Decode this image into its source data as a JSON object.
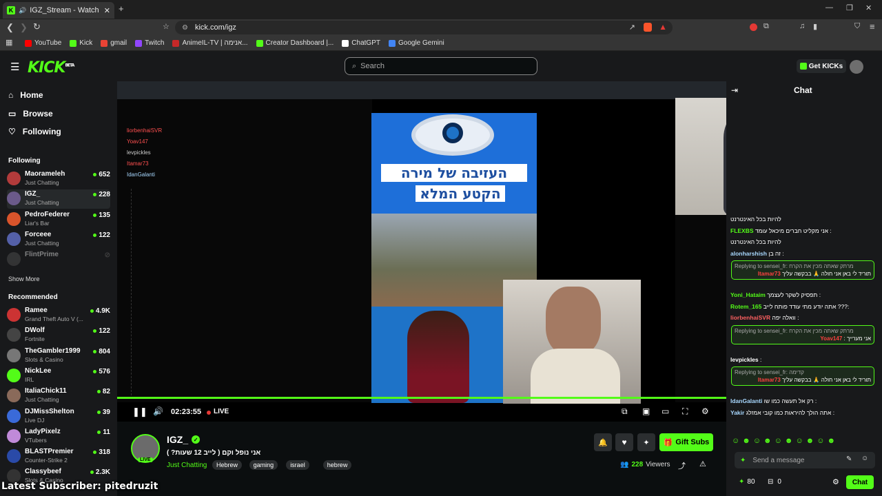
{
  "browser": {
    "tab_title": "IGZ_Stream - Watch Live on K",
    "url": "kick.com/igz",
    "bookmarks": [
      {
        "label": "YouTube",
        "color": "#ff0000"
      },
      {
        "label": "Kick",
        "color": "#53fc18"
      },
      {
        "label": "gmail",
        "color": "#ea4335"
      },
      {
        "label": "Twitch",
        "color": "#9146ff"
      },
      {
        "label": "AnimeIL-TV | אנימה...",
        "color": "#c62828"
      },
      {
        "label": "Creator Dashboard |...",
        "color": "#53fc18"
      },
      {
        "label": "ChatGPT",
        "color": "#ffffff"
      },
      {
        "label": "Google Gemini",
        "color": "#4285f4"
      }
    ]
  },
  "header": {
    "logo": "KICK",
    "logo_beta": "BETA",
    "search_placeholder": "Search",
    "get_kicks": "Get KICKs"
  },
  "sidebar": {
    "nav": [
      "Home",
      "Browse",
      "Following"
    ],
    "following_title": "Following",
    "following": [
      {
        "name": "Maorameleh",
        "category": "Just Chatting",
        "viewers": "652",
        "color": "#b23b3b"
      },
      {
        "name": "IGZ_",
        "category": "Just Chatting",
        "viewers": "228",
        "color": "#6b5a8a"
      },
      {
        "name": "PedroFederer",
        "category": "Liar's Bar",
        "viewers": "135",
        "color": "#d9542b"
      },
      {
        "name": "Forceee",
        "category": "Just Chatting",
        "viewers": "122",
        "color": "#5460a8"
      },
      {
        "name": "FlintPrime",
        "category": "",
        "viewers": "",
        "color": "#555555"
      }
    ],
    "show_more": "Show More",
    "recommended_title": "Recommended",
    "recommended": [
      {
        "name": "Ramee",
        "category": "Grand Theft Auto V (...",
        "viewers": "4.9K",
        "color": "#cc3333"
      },
      {
        "name": "DWolf",
        "category": "Fortnite",
        "viewers": "122",
        "color": "#444444"
      },
      {
        "name": "TheGambler1999",
        "category": "Slots & Casino",
        "viewers": "804",
        "color": "#777777"
      },
      {
        "name": "NickLee",
        "category": "IRL",
        "viewers": "576",
        "color": "#53fc18"
      },
      {
        "name": "ItaliaChick11",
        "category": "Just Chatting",
        "viewers": "82",
        "color": "#8a6a5a"
      },
      {
        "name": "DJMissShelton",
        "category": "Live DJ",
        "viewers": "39",
        "color": "#3a6ad9"
      },
      {
        "name": "LadyPixelz",
        "category": "VTubers",
        "viewers": "11",
        "color": "#c08ad9"
      },
      {
        "name": "BLASTPremier",
        "category": "Counter-Strike 2",
        "viewers": "318",
        "color": "#2a4aa8"
      },
      {
        "name": "Classybeef",
        "category": "Slots & Casino",
        "viewers": "2.3K",
        "color": "#333333"
      }
    ]
  },
  "player": {
    "time": "02:23:55",
    "live_label": "LIVE",
    "overlay_text_1": "העזיבה של מירה",
    "overlay_text_2": "הקטע המלא",
    "progress": 1.0
  },
  "stream": {
    "streamer": "IGZ_",
    "live_badge": "LIVE",
    "title": "אני נופל וקם ( לייב 12 שעות? )",
    "category": "Just Chatting",
    "tags": [
      "Hebrew",
      "gaming",
      "israel",
      "hebrew"
    ],
    "viewers": "228",
    "viewers_label": "Viewers",
    "gift_subs": "Gift Subs"
  },
  "chat": {
    "title": "Chat",
    "messages": [
      {
        "type": "text",
        "user": "",
        "user_color": "#fff",
        "text": "להיות בכל האינטרנט"
      },
      {
        "type": "text",
        "user": "FLEXBS",
        "user_color": "#53fc18",
        "text": "אני מקליט חברים מיכאל עומד :"
      },
      {
        "type": "text",
        "user": "",
        "user_color": "#fff",
        "text": "להיות בכל האינטרנט"
      },
      {
        "type": "text",
        "user": "alonharshish",
        "user_color": "#a8d8ff",
        "text": "זה בן :"
      },
      {
        "type": "reply",
        "reply_to": "Replying to sensei_fr: מרתק שאתה מכין את הקרח",
        "user": "Itamar73",
        "user_color": "#ff4040",
        "text": "תוריד לי באן אני חולה 🙏 בבקשה עליך"
      },
      {
        "type": "text",
        "user": "Yoni_Hataim",
        "user_color": "#53fc18",
        "text": "תפסיק לשקר לעצמך :"
      },
      {
        "type": "text",
        "user": "Rotem_165",
        "user_color": "#53fc18",
        "text": "אתה יודע מתי עודד פותח לייב ???:"
      },
      {
        "type": "text",
        "user": "liorbenhaiSVR",
        "user_color": "#ff6060",
        "text": "וואלה יפה :"
      },
      {
        "type": "reply",
        "reply_to": "Replying to sensei_fr: מרתק שאתה מכין את הקרח",
        "user": "Yoav147",
        "user_color": "#ff4040",
        "text": "אני מערייך :"
      },
      {
        "type": "text",
        "user": "levpickles",
        "user_color": "#fff",
        "text": ":"
      },
      {
        "type": "reply",
        "reply_to": "Replying to sensei_fr: קדימה",
        "user": "Itamar73",
        "user_color": "#ff4040",
        "text": "תוריד לי באן אני חולה 🙏 בבקשה עליך"
      },
      {
        "type": "text",
        "user": "IdanGalanti",
        "user_color": "#a8d8ff",
        "text": "רק אל תעשה כמו שו :"
      },
      {
        "type": "text",
        "user": "Yakir",
        "user_color": "#a8d8ff",
        "text": "אתה הולך להיראות כמו קובי אמזלג :"
      }
    ],
    "input_placeholder": "Send a message",
    "points": "80",
    "gifts": "0",
    "send_label": "Chat"
  },
  "overlay": {
    "latest_subscriber": "Latest Subscriber: pitedruzit"
  }
}
